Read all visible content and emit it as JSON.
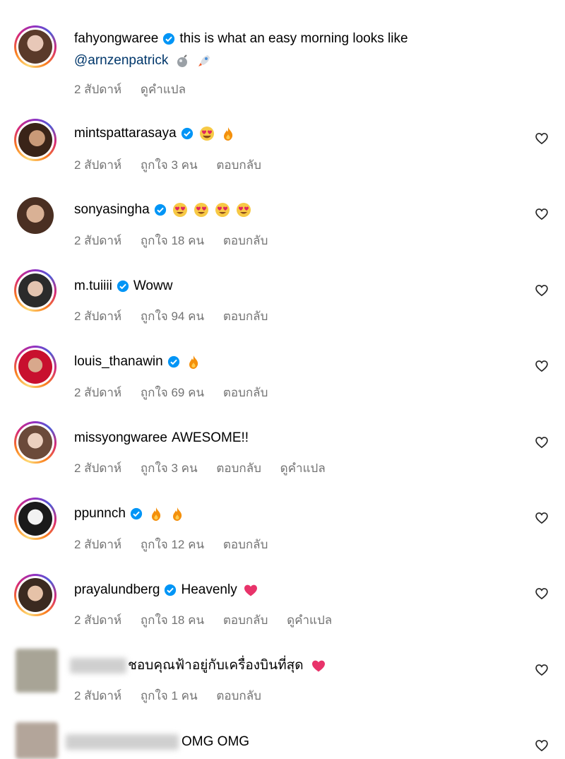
{
  "caption": {
    "username": "fahyongwaree",
    "text": "this is what an easy morning looks like",
    "mention": "@arnzenpatrick",
    "time": "2 สัปดาห์",
    "translate": "ดูคำแปล"
  },
  "comments": [
    {
      "username": "mintspattarasaya",
      "verified": true,
      "emojis": [
        "heart-eyes",
        "fire"
      ],
      "time": "2 สัปดาห์",
      "likes": "ถูกใจ 3 คน",
      "reply": "ตอบกลับ"
    },
    {
      "username": "sonyasingha",
      "verified": true,
      "emojis": [
        "heart-eyes",
        "heart-eyes",
        "heart-eyes",
        "heart-eyes"
      ],
      "time": "2 สัปดาห์",
      "likes": "ถูกใจ 18 คน",
      "reply": "ตอบกลับ"
    },
    {
      "username": "m.tuiiii",
      "verified": true,
      "text": "Woww",
      "time": "2 สัปดาห์",
      "likes": "ถูกใจ 94 คน",
      "reply": "ตอบกลับ"
    },
    {
      "username": "louis_thanawin",
      "verified": true,
      "emojis": [
        "fire"
      ],
      "time": "2 สัปดาห์",
      "likes": "ถูกใจ 69 คน",
      "reply": "ตอบกลับ"
    },
    {
      "username": "missyongwaree",
      "verified": false,
      "text": "AWESOME!!",
      "time": "2 สัปดาห์",
      "likes": "ถูกใจ 3 คน",
      "reply": "ตอบกลับ",
      "translate": "ดูคำแปล"
    },
    {
      "username": "ppunnch",
      "verified": true,
      "emojis": [
        "fire",
        "fire"
      ],
      "time": "2 สัปดาห์",
      "likes": "ถูกใจ 12 คน",
      "reply": "ตอบกลับ"
    },
    {
      "username": "prayalundberg",
      "verified": true,
      "text": "Heavenly",
      "emojis": [
        "red-heart"
      ],
      "time": "2 สัปดาห์",
      "likes": "ถูกใจ 18 คน",
      "reply": "ตอบกลับ",
      "translate": "ดูคำแปล"
    },
    {
      "username_blurred": true,
      "text": "ชอบคุณฟ้าอยู่กับเครื่องบินที่สุด",
      "emojis": [
        "red-heart"
      ],
      "time": "2 สัปดาห์",
      "likes": "ถูกใจ 1 คน",
      "reply": "ตอบกลับ"
    },
    {
      "username_blurred": true,
      "text": "OMG OMG"
    }
  ]
}
